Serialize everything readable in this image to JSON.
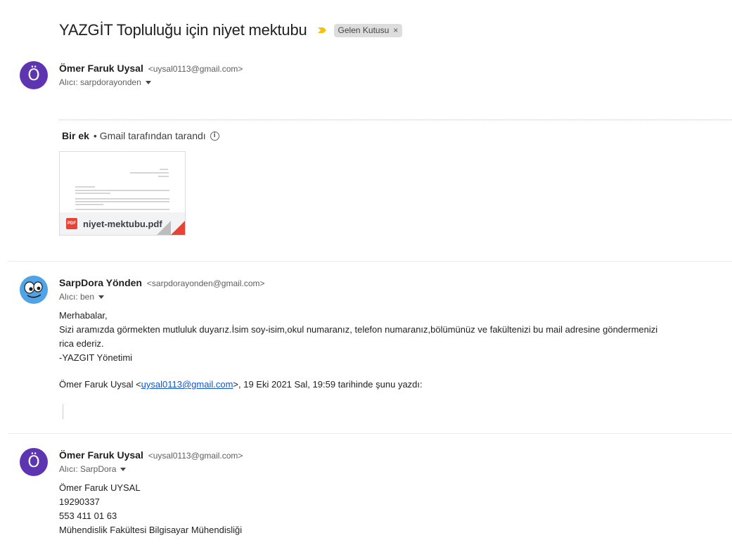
{
  "thread": {
    "subject": "YAZGİT Topluluğu için niyet mektubu",
    "label": "Gelen Kutusu",
    "label_remove": "×",
    "importance_color": "#f4c20d"
  },
  "messages": [
    {
      "avatar_letter": "Ö",
      "sender_name": "Ömer Faruk Uysal",
      "sender_email": "<uysal0113@gmail.com>",
      "recipient": "Alıcı: sarpdorayonden",
      "attachment_header": {
        "count": "Bir ek",
        "scan_text": "• Gmail tarafından tarandı",
        "info_icon": "i"
      },
      "attachment": {
        "file_type": "PDF",
        "file_name": "niyet-mektubu.pdf"
      }
    },
    {
      "avatar_icon": "cartoon-face-avatar",
      "sender_name": "SarpDora Yönden",
      "sender_email": "<sarpdorayonden@gmail.com>",
      "recipient": "Alıcı: ben",
      "body_lines": [
        "Merhabalar,",
        "Sizi aramızda görmekten mutluluk duyarız.İsim soy-isim,okul numaranız, telefon numaranız,bölümünüz ve fakültenizi bu mail adresine göndermenizi",
        "rica ederiz.",
        "-YAZGIT Yönetimi"
      ],
      "quote_intro": {
        "prefix": "Ömer Faruk Uysal <",
        "link": "uysal0113@gmail.com",
        "suffix": ">, 19 Eki 2021 Sal, 19:59 tarihinde şunu yazdı:"
      }
    },
    {
      "avatar_letter": "Ö",
      "sender_name": "Ömer Faruk Uysal",
      "sender_email": "<uysal0113@gmail.com>",
      "recipient": "Alıcı: SarpDora",
      "body_lines": [
        "Ömer Faruk UYSAL",
        "19290337",
        "553 411 01 63",
        "Mühendislik Fakültesi Bilgisayar Mühendisliği"
      ]
    }
  ],
  "colors": {
    "avatar_purple": "#5e35b1",
    "avatar_blue": "#4fa3e6",
    "link": "#1155cc",
    "pdf_red": "#ea4335"
  }
}
